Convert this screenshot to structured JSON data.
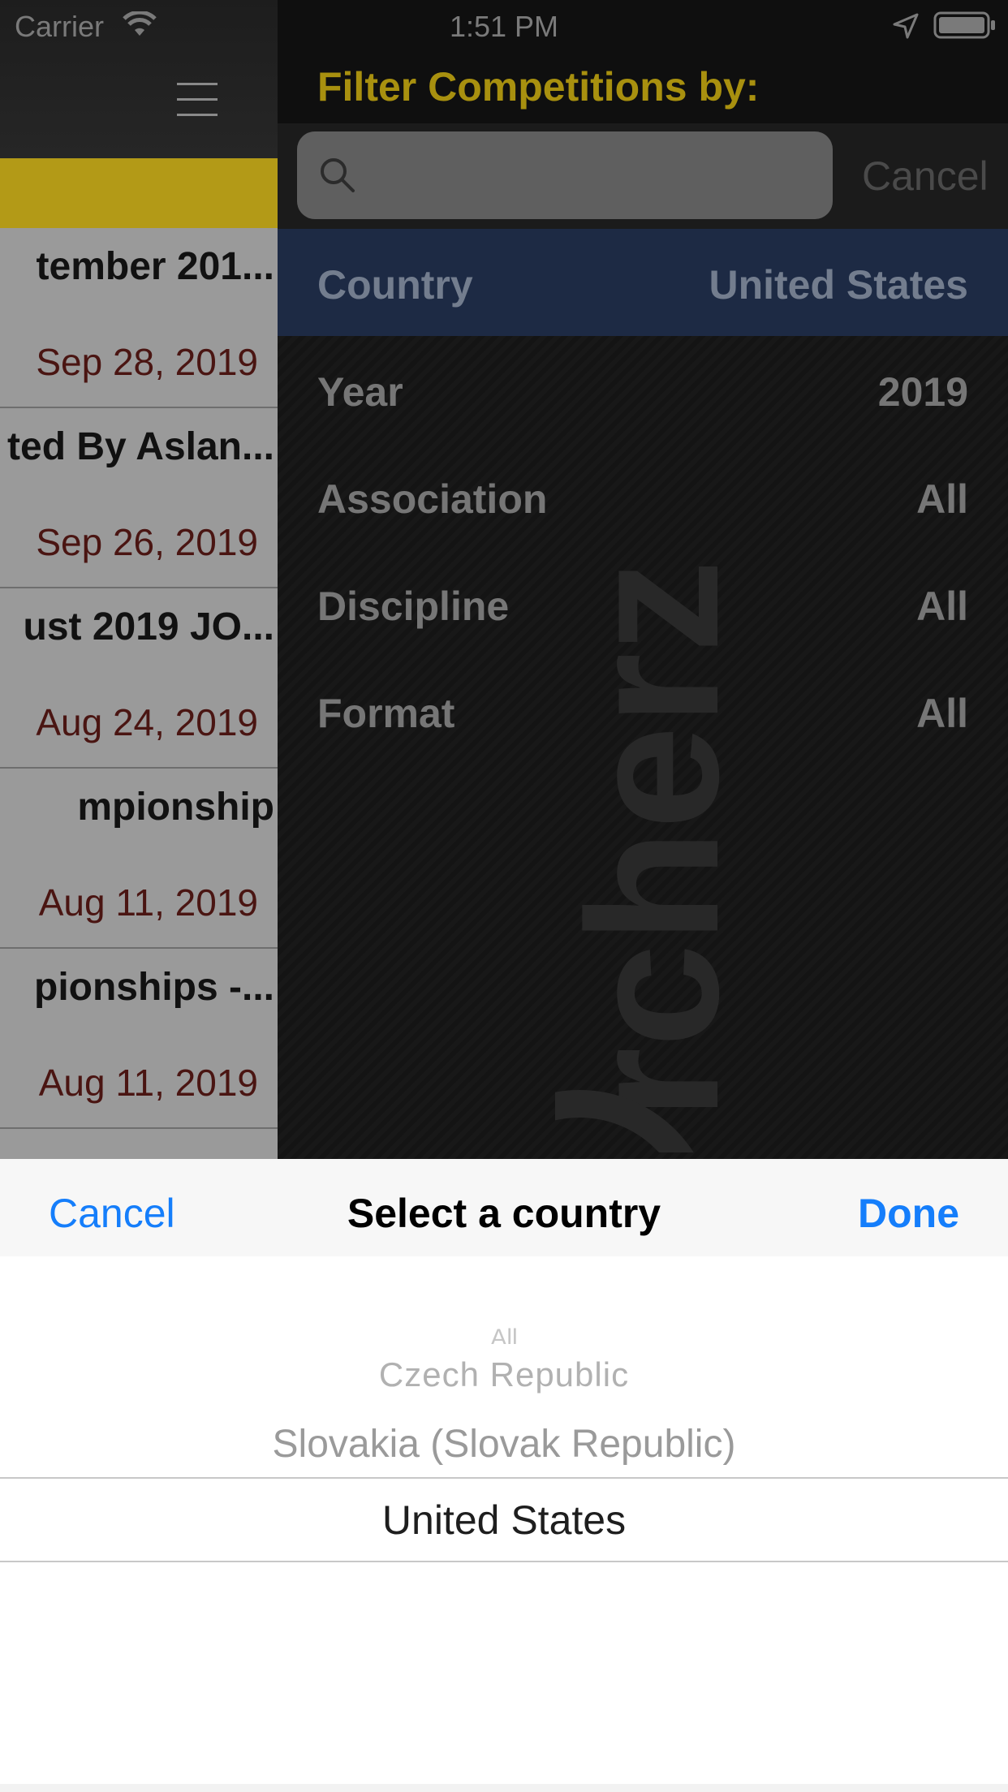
{
  "status_bar": {
    "carrier": "Carrier",
    "time": "1:51 PM",
    "icons": [
      "wifi-icon",
      "location-icon",
      "battery-icon"
    ]
  },
  "competitions": [
    {
      "title": "tember 201...",
      "date": "Sep 28, 2019"
    },
    {
      "title": "ted By Aslan...",
      "date": "Sep 26, 2019"
    },
    {
      "title": "ust 2019 JO...",
      "date": "Aug 24, 2019"
    },
    {
      "title": "mpionship",
      "date": "Aug 11, 2019"
    },
    {
      "title": "pionships -...",
      "date": "Aug 11, 2019"
    }
  ],
  "filter": {
    "title": "Filter Competitions by:",
    "search_placeholder": "",
    "search_cancel": "Cancel",
    "rows": [
      {
        "label": "Country",
        "value": "United States"
      },
      {
        "label": "Year",
        "value": "2019"
      },
      {
        "label": "Association",
        "value": "All"
      },
      {
        "label": "Discipline",
        "value": "All"
      },
      {
        "label": "Format",
        "value": "All"
      }
    ],
    "watermark": "rcherz"
  },
  "picker": {
    "cancel_label": "Cancel",
    "title": "Select a country",
    "done_label": "Done",
    "options": [
      "All",
      "Czech Republic",
      "Slovakia (Slovak Republic)",
      "United States"
    ],
    "selected": "United States"
  },
  "colors": {
    "accent_blue": "#157efb",
    "brand_yellow": "#b39a17",
    "date_red": "#4a1512",
    "selected_row": "#1d2a44"
  }
}
